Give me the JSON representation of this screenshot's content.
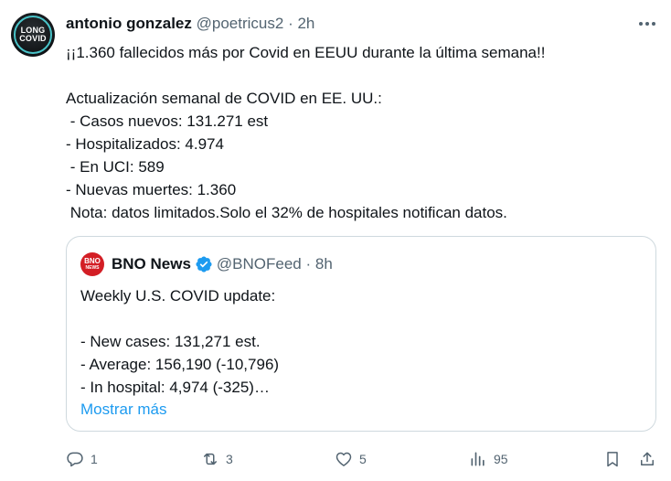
{
  "tweet": {
    "author_name": "antonio gonzalez",
    "author_handle": "@poetricus2",
    "separator": "·",
    "time": "2h",
    "avatar_text_line1": "LONG",
    "avatar_text_line2": "COVID",
    "text": "¡¡1.360 fallecidos más por Covid en EEUU durante la última semana!!\n\nActualización semanal de COVID en EE. UU.:\n - Casos nuevos: 131.271 est\n- Hospitalizados: 4.974\n - En UCI: 589\n- Nuevas muertes: 1.360\n Nota: datos limitados.Solo el 32% de hospitales notifican datos."
  },
  "quote": {
    "author_name": "BNO News",
    "author_handle": "@BNOFeed",
    "separator": "·",
    "time": "8h",
    "avatar_text_line1": "BNO",
    "avatar_text_line2": "NEWS",
    "text": "Weekly U.S. COVID update:\n\n- New cases: 131,271 est.\n- Average: 156,190 (-10,796)\n- In hospital: 4,974 (-325)…",
    "show_more": "Mostrar más"
  },
  "actions": {
    "reply_count": "1",
    "retweet_count": "3",
    "like_count": "5",
    "view_count": "95"
  },
  "colors": {
    "link": "#1d9bf0",
    "muted": "#536471",
    "border": "#cfd9de",
    "verified": "#1d9bf0",
    "bno_red": "#d31e25"
  }
}
